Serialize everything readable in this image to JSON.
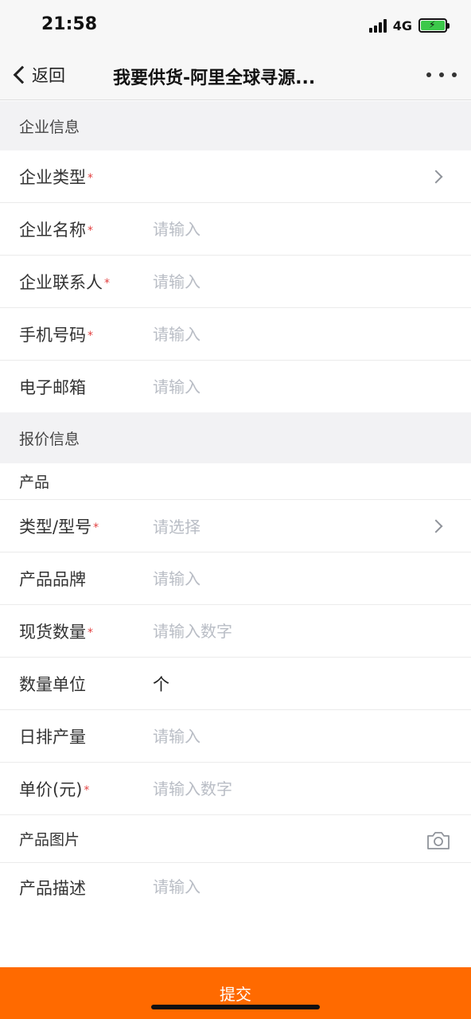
{
  "status_bar": {
    "time": "21:58",
    "network": "4G"
  },
  "nav": {
    "back_label": "返回",
    "title": "我要供货-阿里全球寻源..."
  },
  "company_section": {
    "header": "企业信息",
    "type_label": "企业类型",
    "name_label": "企业名称",
    "name_placeholder": "请输入",
    "contact_label": "企业联系人",
    "contact_placeholder": "请输入",
    "phone_label": "手机号码",
    "phone_placeholder": "请输入",
    "email_label": "电子邮箱",
    "email_placeholder": "请输入"
  },
  "quote_section": {
    "header": "报价信息",
    "product_sub_label": "产品",
    "model_label": "类型/型号",
    "model_placeholder": "请选择",
    "brand_label": "产品品牌",
    "brand_placeholder": "请输入",
    "stock_label": "现货数量",
    "stock_placeholder": "请输入数字",
    "unit_label": "数量单位",
    "unit_value": "个",
    "daily_output_label": "日排产量",
    "daily_output_placeholder": "请输入",
    "price_label": "单价(元)",
    "price_placeholder": "请输入数字",
    "images_label": "产品图片",
    "description_label": "产品描述",
    "description_placeholder": "请输入"
  },
  "submit_label": "提交",
  "colors": {
    "accent": "#ff6a00",
    "required": "#e24040",
    "placeholder": "#b9bdc5",
    "section_bg": "#f2f2f4"
  },
  "icons": [
    "back-chevron-icon",
    "more-icon",
    "chevron-right-icon",
    "camera-icon"
  ]
}
